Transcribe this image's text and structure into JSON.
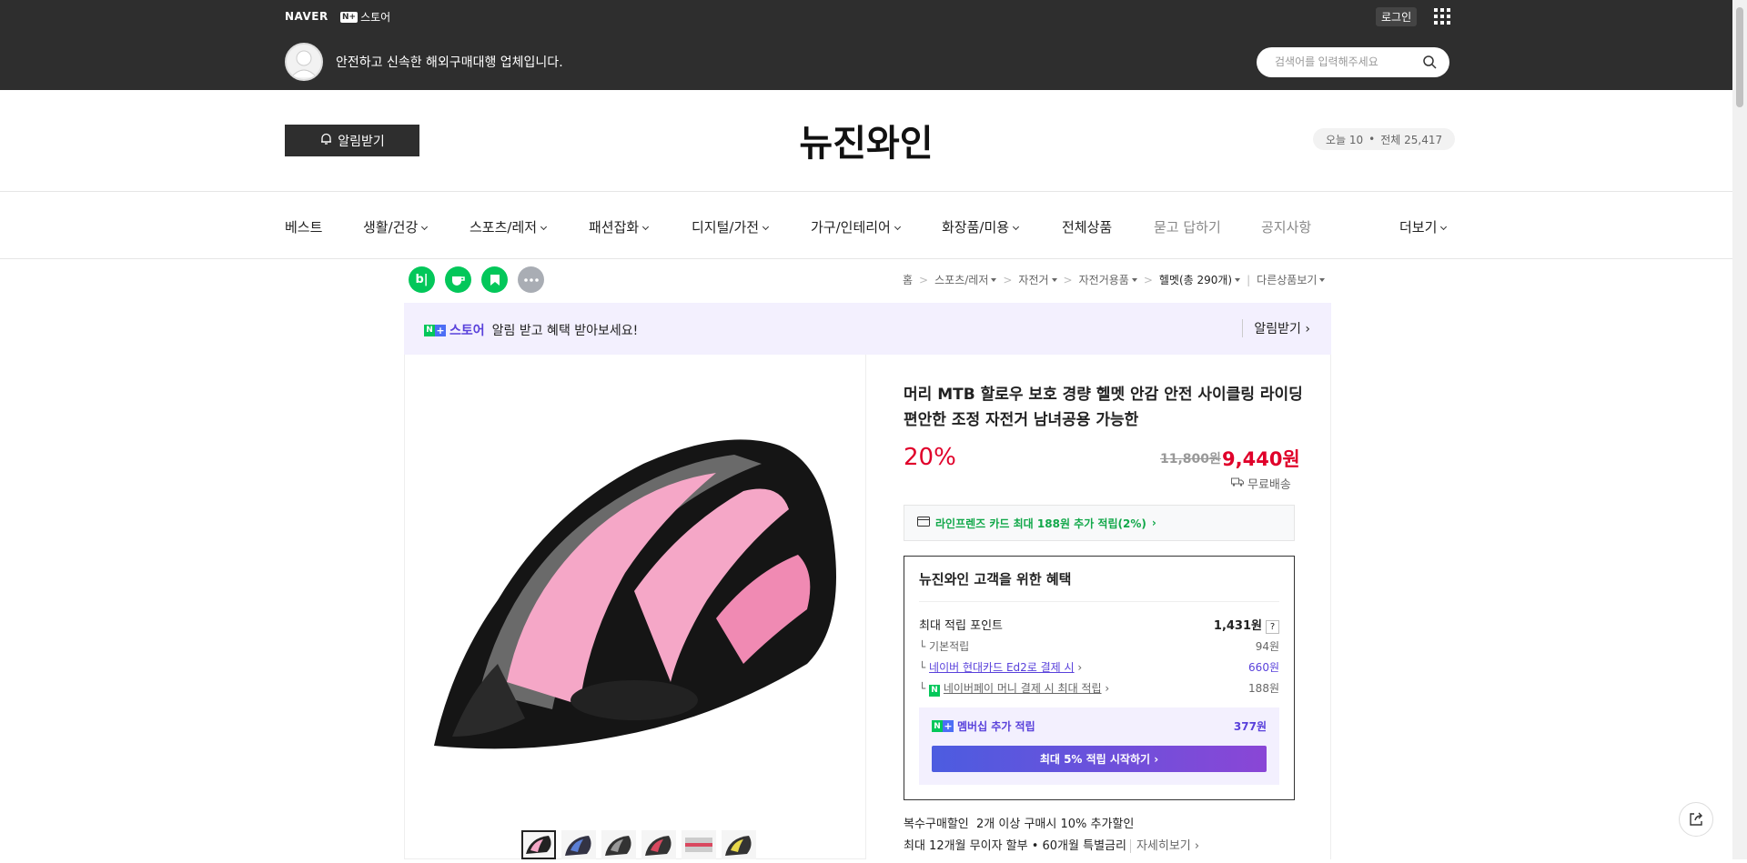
{
  "topbar": {
    "naver_logo": "NAVER",
    "nplus_n": "N+",
    "nplus_store": "스토어",
    "login": "로그인",
    "slogan": "안전하고 신속한 해외구매대행 업체입니다.",
    "search_placeholder": "검색어를 입력해주세요"
  },
  "header": {
    "alarm_button": "알림받기",
    "store_name": "뉴진와인",
    "visit_today": "오늘 10",
    "visit_dot": "•",
    "visit_total": "전체 25,417"
  },
  "nav": {
    "items": [
      {
        "label": "베스트"
      },
      {
        "label": "생활/건강"
      },
      {
        "label": "스포츠/레저"
      },
      {
        "label": "패션잡화"
      },
      {
        "label": "디지털/가전"
      },
      {
        "label": "가구/인테리어"
      },
      {
        "label": "화장품/미용"
      },
      {
        "label": "전체상품"
      },
      {
        "label": "묻고 답하기"
      },
      {
        "label": "공지사항"
      },
      {
        "label": "더보기"
      }
    ]
  },
  "share_icons": {
    "blog": "b|"
  },
  "breadcrumb": {
    "home": "홈",
    "cat1": "스포츠/레저",
    "cat2": "자전거",
    "cat3": "자전거용품",
    "current": "헬멧(총 290개)",
    "others": "다른상품보기",
    "sep": ">"
  },
  "banner": {
    "store_label": "스토어",
    "message": "알림 받고 혜택 받아보세요!",
    "action": "알림받기"
  },
  "product": {
    "title": "머리 MTB 할로우 보호 경량 헬멧 안감 안전 사이클링 라이딩 편안한 조정 자전거 남녀공용 가능한",
    "discount": "20%",
    "original_price": "11,800원",
    "price": "9,440원",
    "shipping": "무료배송",
    "card_offer": "라인프렌즈 카드 최대 188원 추가 적립(2%)"
  },
  "benefit": {
    "title": "뉴진와인 고객을 위한 혜택",
    "max_point_label": "최대 적립 포인트",
    "max_point_value": "1,431원",
    "help": "?",
    "rows": [
      {
        "label": "기본적립",
        "value": "94원"
      },
      {
        "label": "네이버 현대카드 Ed2로 결제 시",
        "value": "660원"
      },
      {
        "label": "네이버페이 머니 결제 시 최대 적립",
        "value": "188원"
      }
    ],
    "membership_label": "멤버십 추가 적립",
    "membership_value": "377원",
    "membership_button": "최대 5% 적립 시작하기"
  },
  "extra": {
    "multi_label": "복수구매할인",
    "multi_value": "2개 이상 구매시 10% 추가할인",
    "installment": "최대 12개월 무이자 할부 • 60개월 특별금리",
    "installment_more": "자세히보기"
  },
  "colors": {
    "topbar": "#2e2e2e",
    "naver_green": "#03c75a",
    "discount_red": "#e0002a",
    "membership_purple": "#5941db"
  }
}
